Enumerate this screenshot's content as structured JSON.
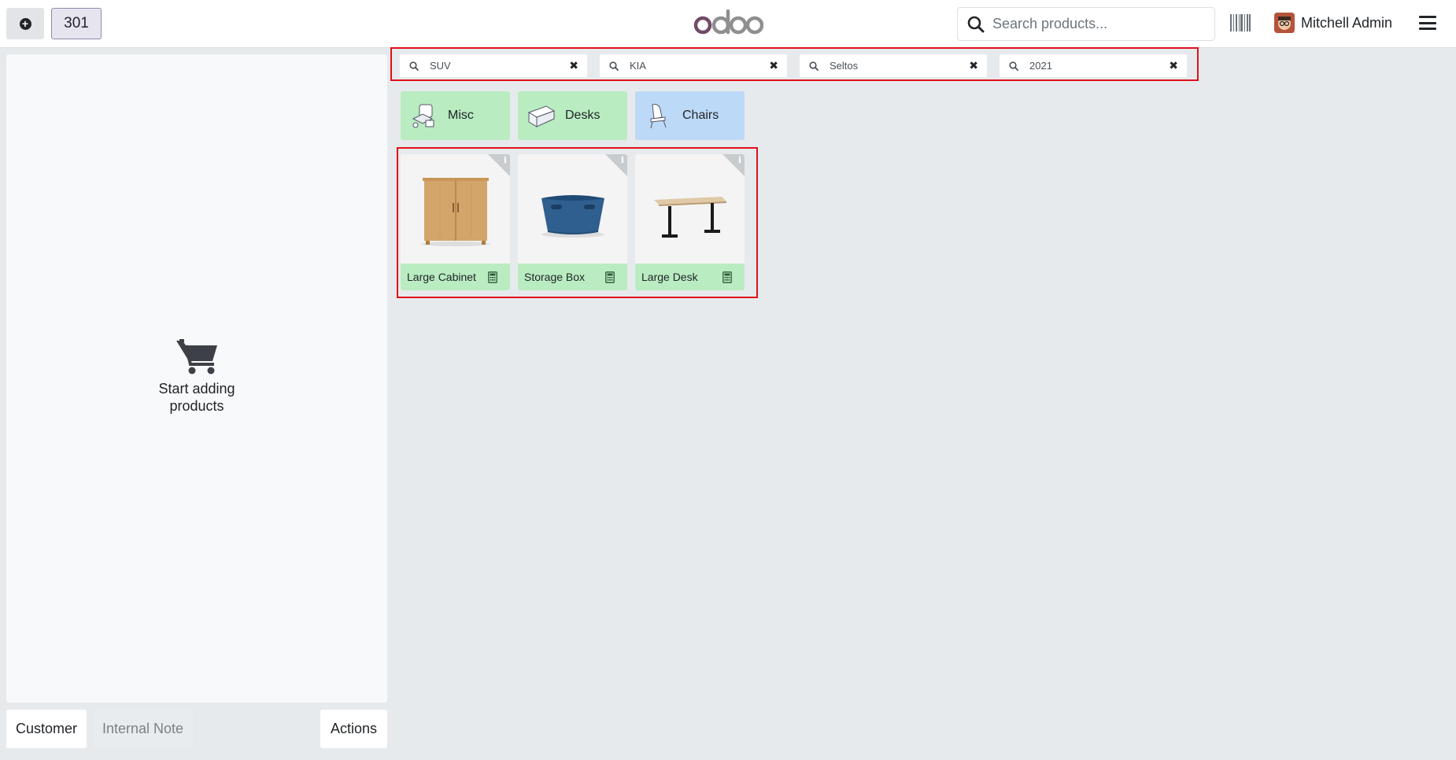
{
  "header": {
    "order_number": "301",
    "search_placeholder": "Search products...",
    "user_name": "Mitchell Admin"
  },
  "cart": {
    "empty_text": "Start adding products"
  },
  "bottom_bar": {
    "customer": "Customer",
    "internal_note": "Internal Note",
    "actions": "Actions"
  },
  "filters": [
    {
      "text": "SUV"
    },
    {
      "text": "KIA"
    },
    {
      "text": "Seltos"
    },
    {
      "text": "2021"
    }
  ],
  "categories": [
    {
      "label": "Misc",
      "color": "#b9ecc1"
    },
    {
      "label": "Desks",
      "color": "#b9ecc1"
    },
    {
      "label": "Chairs",
      "color": "#bcd9f7"
    }
  ],
  "products": [
    {
      "name": "Large Cabinet"
    },
    {
      "name": "Storage Box"
    },
    {
      "name": "Large Desk"
    }
  ],
  "colors": {
    "brand_purple": "#714b67",
    "brand_grey": "#8f8f8f",
    "highlight_red": "#e0101a"
  }
}
